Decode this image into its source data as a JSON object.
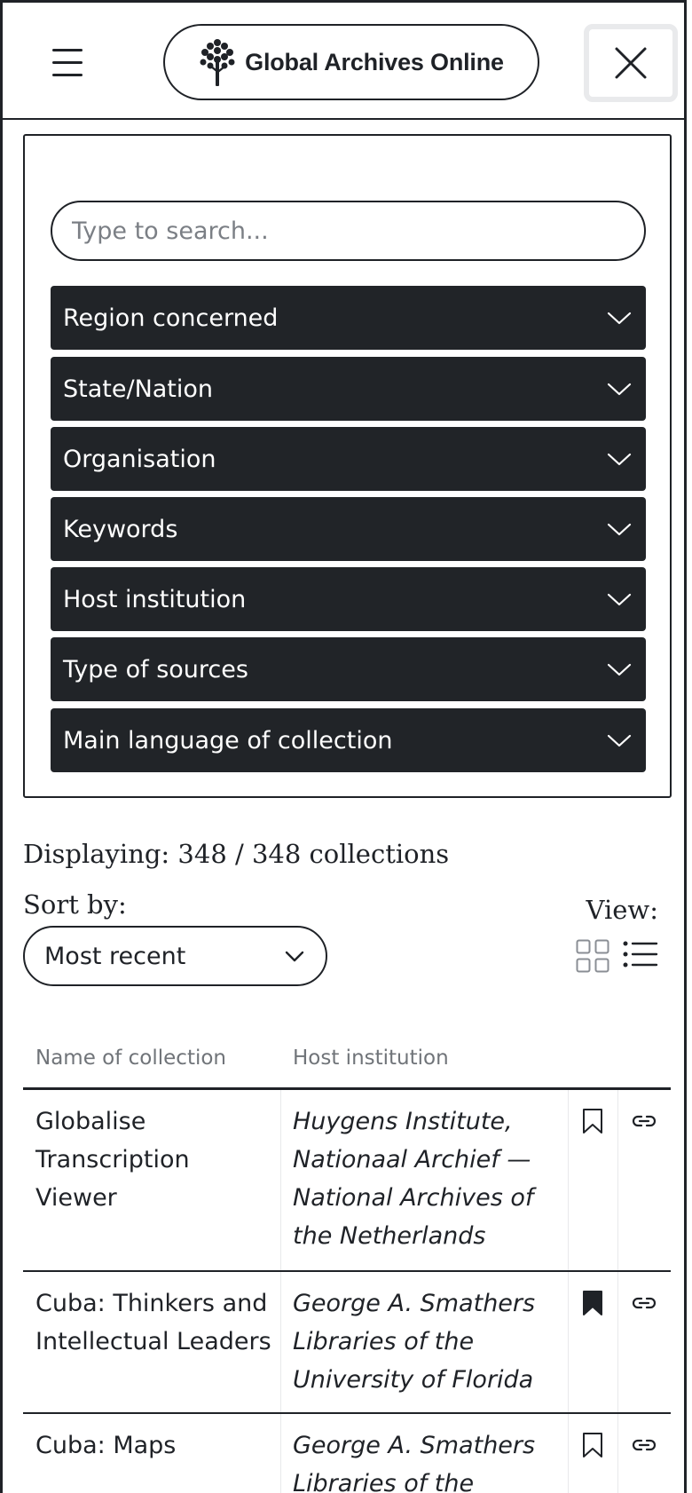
{
  "header": {
    "brand_name": "Global Archives Online",
    "menu_icon": "hamburger-menu-icon",
    "close_icon": "close-icon",
    "logo_icon": "tree-logo-icon"
  },
  "filters": {
    "search_placeholder": "Type to search...",
    "items": [
      {
        "label": "Region concerned"
      },
      {
        "label": "State/Nation"
      },
      {
        "label": "Organisation"
      },
      {
        "label": "Keywords"
      },
      {
        "label": "Host institution"
      },
      {
        "label": "Type of sources"
      },
      {
        "label": "Main language of collection"
      }
    ]
  },
  "results": {
    "displaying": "Displaying: 348 / 348 collections",
    "sort_label": "Sort by:",
    "sort_value": "Most recent",
    "view_label": "View:"
  },
  "table": {
    "headers": {
      "name": "Name of collection",
      "institution": "Host institution"
    },
    "rows": [
      {
        "name": "Globalise Transcription Viewer",
        "institution": "Huygens Institute, Nationaal Archief — National Archives of the Netherlands",
        "bookmarked": false
      },
      {
        "name": "Cuba: Thinkers and Intellectual Leaders",
        "institution": "George A. Smathers Libraries of the University of Florida",
        "bookmarked": true
      },
      {
        "name": "Cuba: Maps",
        "institution": "George A. Smathers Libraries of the",
        "bookmarked": false
      }
    ]
  },
  "colors": {
    "filter_bg": "#212428",
    "text": "#1f2227",
    "muted": "#707479"
  }
}
